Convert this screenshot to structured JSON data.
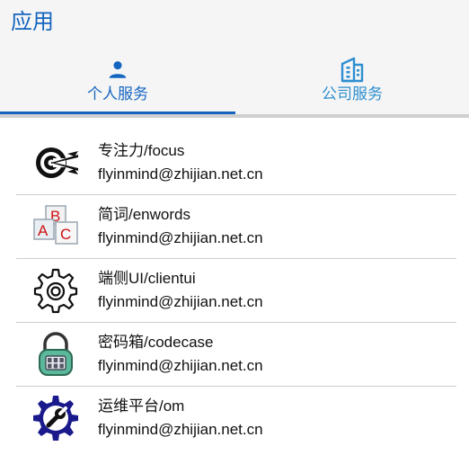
{
  "header": {
    "title": "应用"
  },
  "tabs": [
    {
      "label": "个人服务",
      "icon": "person-icon",
      "active": true
    },
    {
      "label": "公司服务",
      "icon": "building-icon",
      "active": false
    }
  ],
  "apps": [
    {
      "name": "专注力/focus",
      "email": "flyinmind@zhijian.net.cn",
      "icon": "target-icon"
    },
    {
      "name": "简词/enwords",
      "email": "flyinmind@zhijian.net.cn",
      "icon": "abc-blocks-icon"
    },
    {
      "name": "端侧UI/clientui",
      "email": "flyinmind@zhijian.net.cn",
      "icon": "gear-icon"
    },
    {
      "name": "密码箱/codecase",
      "email": "flyinmind@zhijian.net.cn",
      "icon": "padlock-icon"
    },
    {
      "name": "运维平台/om",
      "email": "flyinmind@zhijian.net.cn",
      "icon": "gear-wrench-icon"
    }
  ],
  "colors": {
    "accent": "#1565c0",
    "tab_inactive": "#2f8fd0",
    "header_bg": "#f5f5f5"
  }
}
